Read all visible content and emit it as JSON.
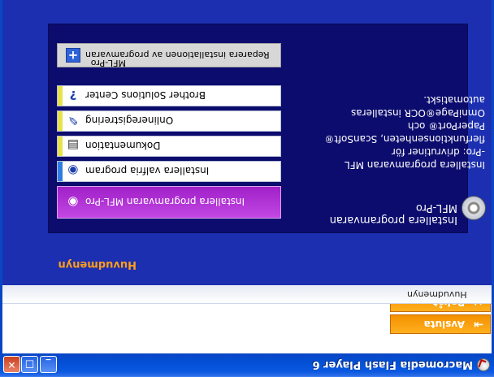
{
  "window": {
    "title": "Macromedia Flash Player 6",
    "minimize": "_",
    "maximize": "□",
    "close": "✕"
  },
  "nav": {
    "back_label": "Bakåt",
    "exit_label": "Avsluta",
    "breadcrumb": "Huvudmenyn"
  },
  "main": {
    "heading": "Huvudmenyn",
    "description_title": "Installera programvaran MFL-Pro",
    "description_lines": [
      "Installera programvaran MFL",
      "-Pro: drivrutiner för",
      "flerfunktionsenheten, ScanSoft®",
      "PaperPort® och",
      "OmniPage®OCR installeras",
      "automatiskt."
    ],
    "menu": [
      {
        "label": "Installera programvaran MFL-Pro",
        "icon": "cd-icon",
        "state": "active"
      },
      {
        "label": "Installera valfria program",
        "icon": "cd-icon",
        "accent": "#2f7de0"
      },
      {
        "label": "Dokumentation",
        "icon": "document-icon",
        "accent": "#e6e34a"
      },
      {
        "label": "Onlineregistrering",
        "icon": "pen-icon",
        "accent": "#e6e34a"
      },
      {
        "label": "Brother Solutions Center",
        "icon": "question-icon",
        "accent": "#e6e34a"
      },
      {
        "label": "Reparera installationen av programvaran",
        "label2": "MFL-Pro",
        "icon": "plus-icon",
        "state": "grey"
      }
    ]
  }
}
